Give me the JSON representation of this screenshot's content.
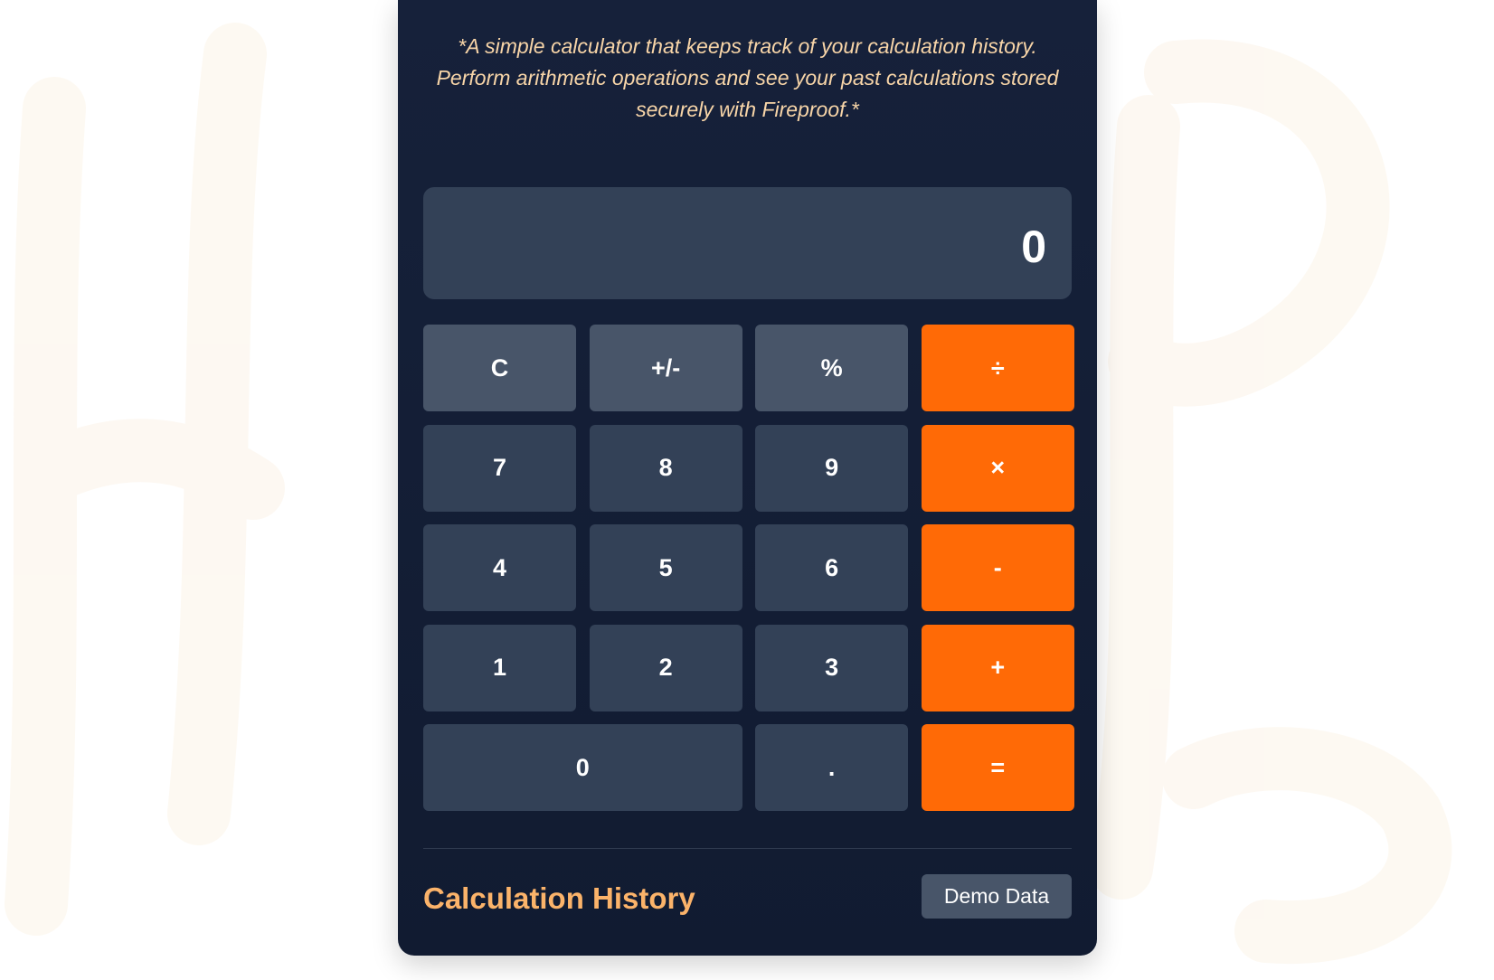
{
  "tagline": "*A simple calculator that keeps track of your calculation history. Perform arithmetic operations and see your past calculations stored securely with Fireproof.*",
  "display": {
    "value": "0"
  },
  "keys": {
    "clear": "C",
    "negate": "+/-",
    "percent": "%",
    "divide": "÷",
    "seven": "7",
    "eight": "8",
    "nine": "9",
    "multiply": "×",
    "four": "4",
    "five": "5",
    "six": "6",
    "subtract": "-",
    "one": "1",
    "two": "2",
    "three": "3",
    "add": "+",
    "zero": "0",
    "decimal": ".",
    "equals": "="
  },
  "history": {
    "title": "Calculation History",
    "demo_button": "Demo Data"
  },
  "colors": {
    "card_background": "#16213a",
    "display_background": "#334157",
    "function_key": "#485569",
    "number_key": "#334157",
    "operator_key": "#ff6a06",
    "tagline_text": "#f8d5a8",
    "history_title_text": "#fbb36a"
  }
}
